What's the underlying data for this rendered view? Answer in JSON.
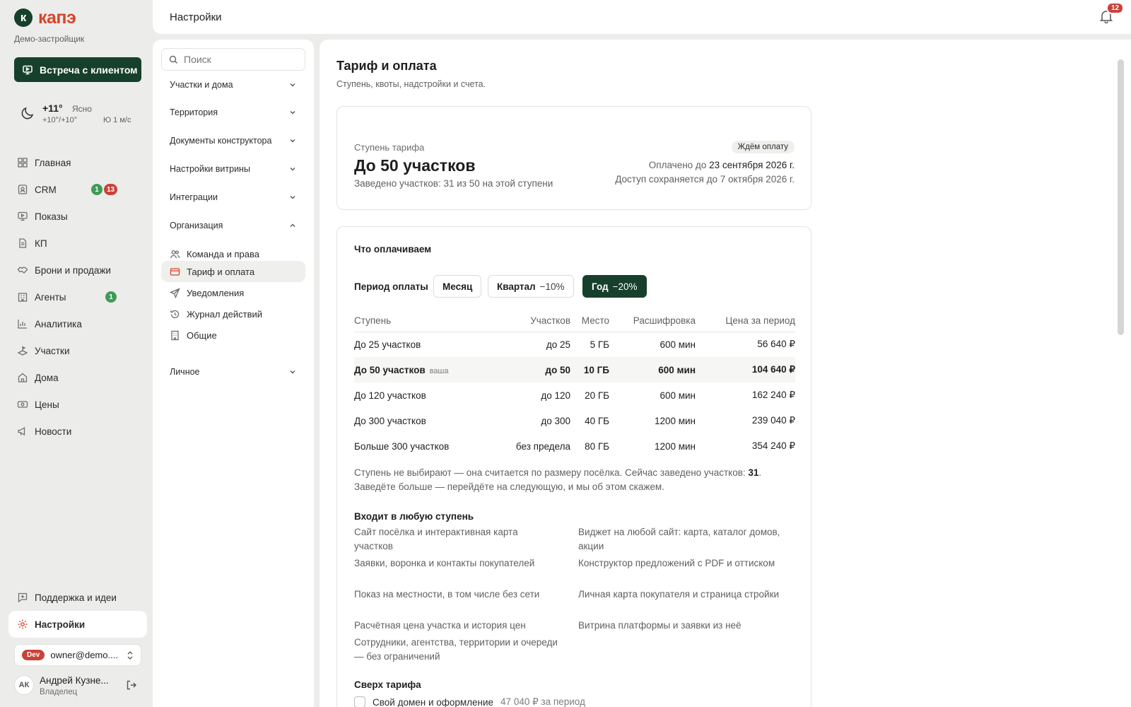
{
  "app": {
    "logo_letter": "к",
    "logo_text": "капэ",
    "org_name": "Демо-застройщик",
    "meet_button": "Встреча с клиентом",
    "brand_color": "#17402c",
    "accent_color": "#d6452b"
  },
  "weather": {
    "temp": "+11°",
    "condition": "Ясно",
    "range": "+10°/+10°",
    "wind": "Ю 1 м/с",
    "icon": "moon-icon"
  },
  "nav": {
    "items": [
      {
        "label": "Главная",
        "icon": "grid-icon"
      },
      {
        "label": "CRM",
        "icon": "contacts-icon",
        "badge_green": "1",
        "badge_red": "13"
      },
      {
        "label": "Показы",
        "icon": "presentation-icon"
      },
      {
        "label": "КП",
        "icon": "document-icon"
      },
      {
        "label": "Брони и продажи",
        "icon": "handshake-icon"
      },
      {
        "label": "Агенты",
        "icon": "building-icon",
        "badge_green": "1"
      },
      {
        "label": "Аналитика",
        "icon": "chart-icon"
      },
      {
        "label": "Участки",
        "icon": "plot-icon"
      },
      {
        "label": "Дома",
        "icon": "home-icon"
      },
      {
        "label": "Цены",
        "icon": "price-icon"
      },
      {
        "label": "Новости",
        "icon": "megaphone-icon"
      }
    ],
    "support": "Поддержка и идеи",
    "settings": "Настройки"
  },
  "account": {
    "env": "Dev",
    "email": "owner@demo....",
    "initials": "АК",
    "name": "Андрей Кузне...",
    "role": "Владелец"
  },
  "topbar": {
    "title": "Настройки",
    "notifications": "12"
  },
  "settings_nav": {
    "search_placeholder": "Поиск",
    "sections": [
      {
        "label": "Участки и дома",
        "expanded": false
      },
      {
        "label": "Территория",
        "expanded": false
      },
      {
        "label": "Документы конструктора",
        "expanded": false
      },
      {
        "label": "Настройки витрины",
        "expanded": false
      },
      {
        "label": "Интеграции",
        "expanded": false
      },
      {
        "label": "Организация",
        "expanded": true
      },
      {
        "label": "Личное",
        "expanded": false
      }
    ],
    "org_items": [
      {
        "label": "Команда и права",
        "icon": "users-icon"
      },
      {
        "label": "Тариф и оплата",
        "icon": "credit-card-icon",
        "active": true
      },
      {
        "label": "Уведомления",
        "icon": "send-icon"
      },
      {
        "label": "Журнал действий",
        "icon": "history-icon"
      },
      {
        "label": "Общие",
        "icon": "office-icon"
      }
    ]
  },
  "page": {
    "title": "Тариф и оплата",
    "subtitle": "Ступень, квоты, надстройки и счета."
  },
  "tier_card": {
    "label": "Ступень тарифа",
    "tier": "До 50 участков",
    "count": "Заведено участков: 31 из 50 на этой ступени",
    "status": "Ждём оплату",
    "paid_prefix": "Оплачено до ",
    "paid_date": "23 сентября 2026 г.",
    "access": "Доступ сохраняется до 7 октября 2026 г."
  },
  "billing": {
    "title": "Что оплачиваем",
    "period_label": "Период оплаты",
    "periods": [
      {
        "label": "Месяц",
        "discount": ""
      },
      {
        "label": "Квартал",
        "discount": "−10%"
      },
      {
        "label": "Год",
        "discount": "−20%",
        "active": true
      }
    ],
    "columns": [
      "Ступень",
      "Участков",
      "Место",
      "Расшифровка",
      "Цена за период"
    ],
    "your_tag": "ваша",
    "rows": [
      {
        "tier": "До 25 участков",
        "plots": "до 25",
        "storage": "5 ГБ",
        "transcript": "600 мин",
        "price": "56 640 ₽"
      },
      {
        "tier": "До 50 участков",
        "plots": "до 50",
        "storage": "10 ГБ",
        "transcript": "600 мин",
        "price": "104 640 ₽",
        "current": true
      },
      {
        "tier": "До 120 участков",
        "plots": "до 120",
        "storage": "20 ГБ",
        "transcript": "600 мин",
        "price": "162 240 ₽"
      },
      {
        "tier": "До 300 участков",
        "plots": "до 300",
        "storage": "40 ГБ",
        "transcript": "1200 мин",
        "price": "239 040 ₽"
      },
      {
        "tier": "Больше 300 участков",
        "plots": "без предела",
        "storage": "80 ГБ",
        "transcript": "1200 мин",
        "price": "354 240 ₽"
      }
    ],
    "note_1": "Ступень не выбирают — она считается по размеру посёлка. Сейчас заведено участков: ",
    "note_count": "31",
    "note_2": ". Заведёте больше — перейдёте на следующую, и мы об этом скажем.",
    "included_title": "Входит в любую ступень",
    "features": [
      "Сайт посёлка и интерактивная карта участков",
      "Виджет на любой сайт: карта, каталог домов, акции",
      "Заявки, воронка и контакты покупателей",
      "Конструктор предложений с PDF и оттиском",
      "Показ на местности, в том числе без сети",
      "Личная карта покупателя и страница стройки",
      "Расчётная цена участка и история цен",
      "Витрина платформы и заявки из неё",
      "Сотрудники, агентства, территории и очереди — без ограничений"
    ],
    "extra_title": "Сверх тарифа",
    "extra_item": "Свой домен и оформление",
    "extra_price": "47 040 ₽ за период"
  }
}
